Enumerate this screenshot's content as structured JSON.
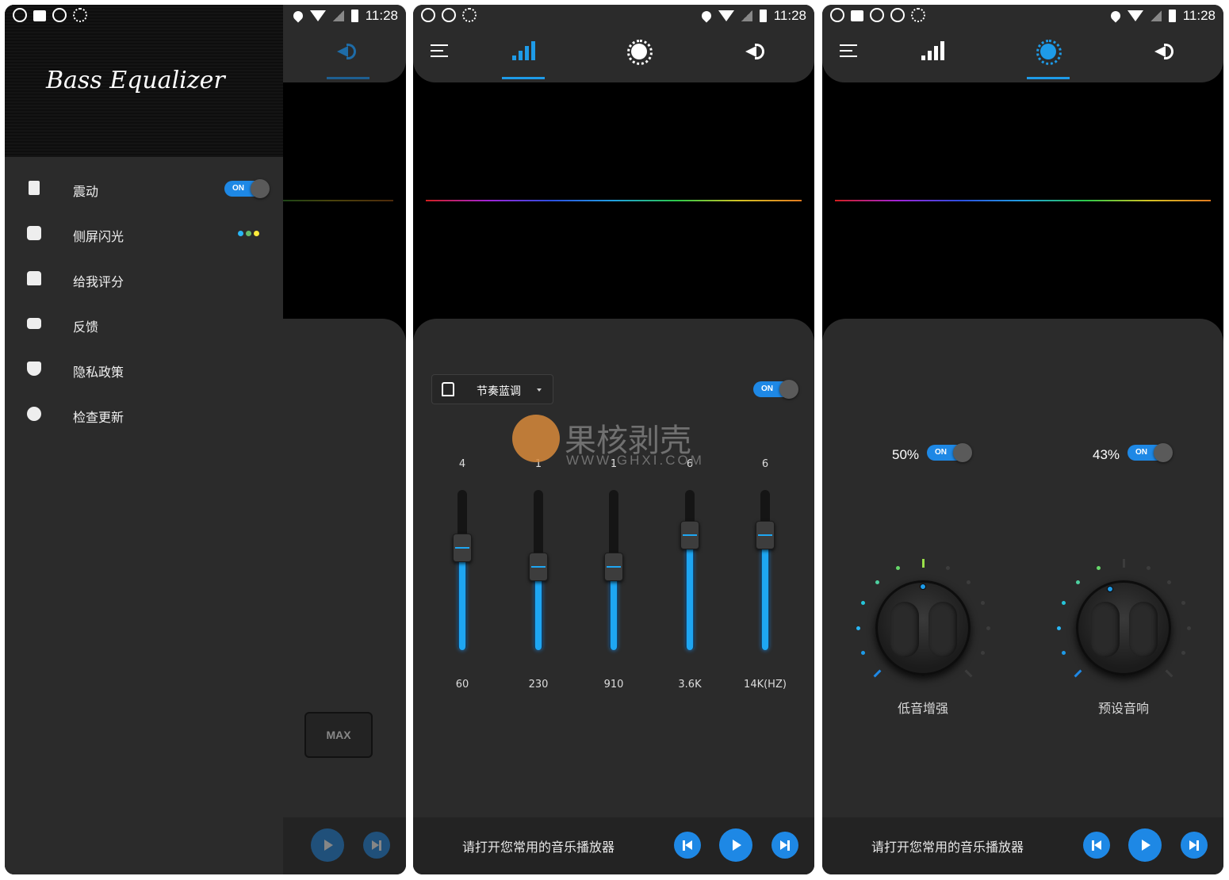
{
  "status": {
    "time": "11:28"
  },
  "drawer": {
    "title": "Bass Equalizer",
    "items": [
      {
        "label": "震动",
        "icon": "vibration-icon",
        "toggle": "ON"
      },
      {
        "label": "侧屏闪光",
        "icon": "edge-light-icon"
      },
      {
        "label": "给我评分",
        "icon": "thumbs-up-icon"
      },
      {
        "label": "反馈",
        "icon": "feedback-icon"
      },
      {
        "label": "隐私政策",
        "icon": "shield-icon"
      },
      {
        "label": "检查更新",
        "icon": "update-icon"
      }
    ],
    "edge_colors": [
      "#29b6f6",
      "#66bb6a",
      "#ffeb3b"
    ],
    "max_label": "MAX"
  },
  "equalizer": {
    "preset": "节奏蓝调",
    "toggle": "ON",
    "bands": [
      {
        "freq": "60",
        "value": "4",
        "level": 0.64
      },
      {
        "freq": "230",
        "value": "1",
        "level": 0.52
      },
      {
        "freq": "910",
        "value": "1",
        "level": 0.52
      },
      {
        "freq": "3.6K",
        "value": "6",
        "level": 0.72
      },
      {
        "freq": "14K(HZ)",
        "value": "6",
        "level": 0.72
      }
    ]
  },
  "bass": {
    "bass_boost": {
      "percent": "50%",
      "toggle": "ON",
      "label": "低音增强",
      "level": 0.5
    },
    "virtualizer": {
      "percent": "43%",
      "toggle": "ON",
      "label": "预设音响",
      "level": 0.43
    }
  },
  "player": {
    "prompt": "请打开您常用的音乐播放器"
  },
  "watermark": {
    "main": "果核剥壳",
    "sub": "WWW.GHXI.COM"
  },
  "colors": {
    "accent": "#1e88e5",
    "panel": "#2b2b2b"
  }
}
